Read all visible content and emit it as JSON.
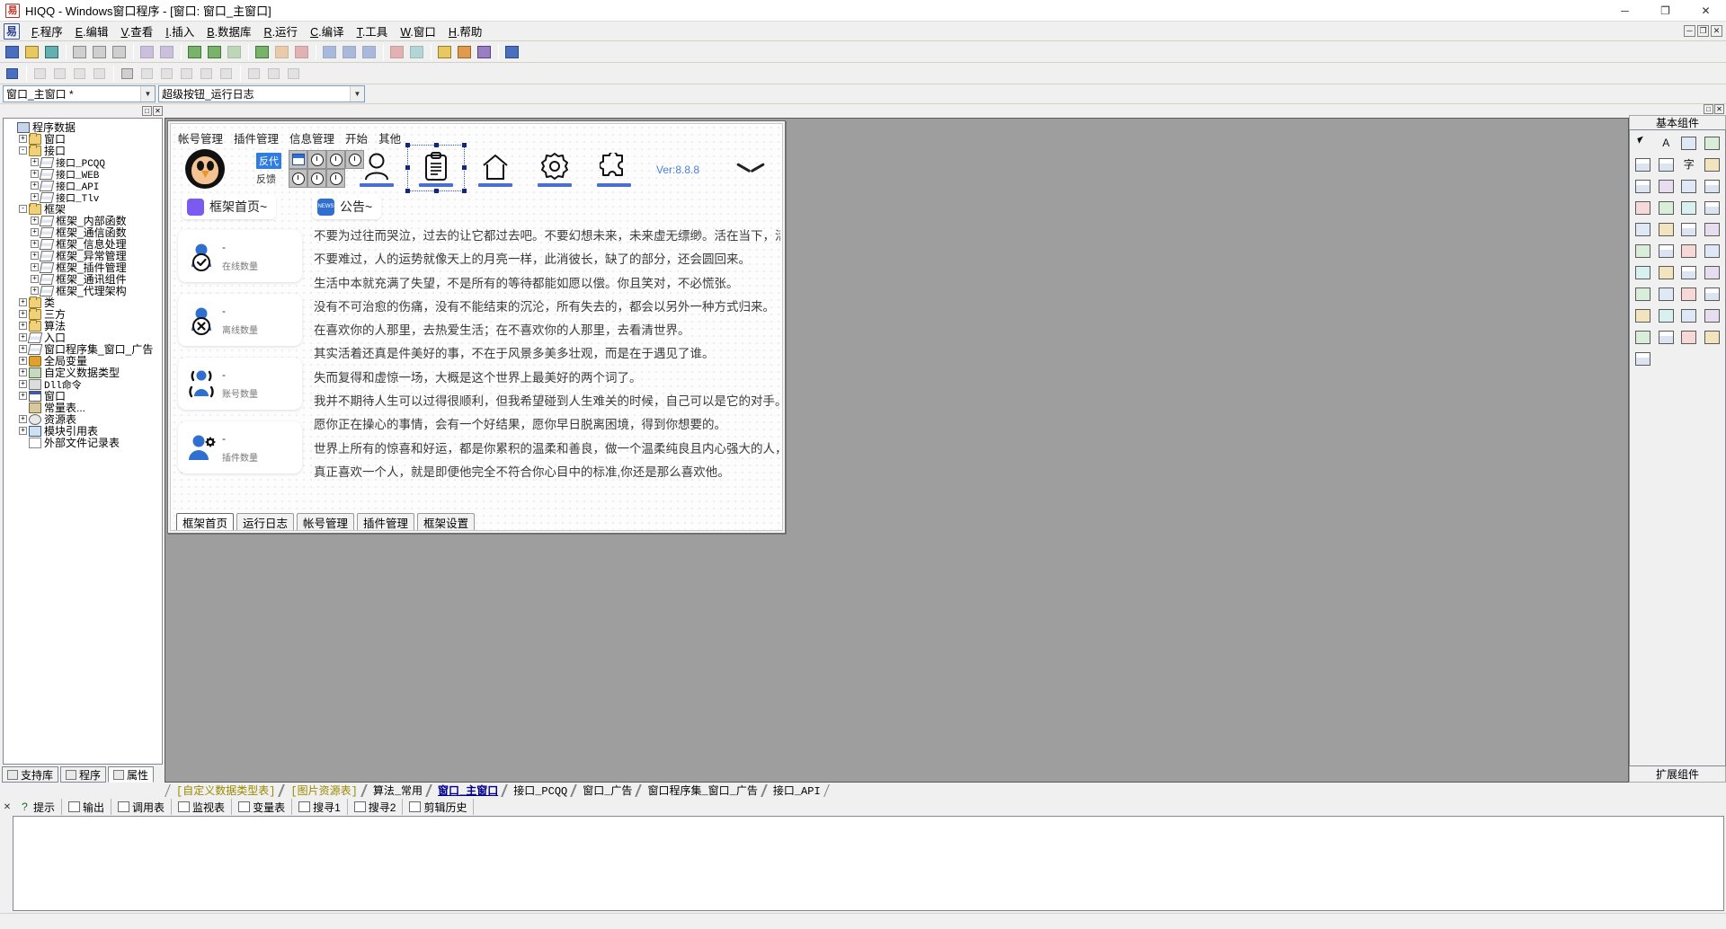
{
  "window": {
    "title": "HIQQ - Windows窗口程序 - [窗口: 窗口_主窗口]",
    "minimize": "─",
    "maximize": "❐",
    "close": "✕"
  },
  "menubar": {
    "items": [
      {
        "key": "F",
        "label": ".程序"
      },
      {
        "key": "E",
        "label": ".编辑"
      },
      {
        "key": "V",
        "label": ".查看"
      },
      {
        "key": "I",
        "label": ".插入"
      },
      {
        "key": "B",
        "label": ".数据库"
      },
      {
        "key": "R",
        "label": ".运行"
      },
      {
        "key": "C",
        "label": ".编译"
      },
      {
        "key": "T",
        "label": ".工具"
      },
      {
        "key": "W",
        "label": ".窗口"
      },
      {
        "key": "H",
        "label": ".帮助"
      }
    ],
    "win_buttons": [
      "─",
      "❐",
      "✕"
    ]
  },
  "combos": {
    "object_selector": "窗口_主窗口 *",
    "event_selector": "超级按钮_运行日志"
  },
  "left_panel": {
    "caption_buttons": [
      "□",
      "✕"
    ],
    "tree": [
      {
        "depth": 0,
        "expander": "",
        "icon": "program-data-icon",
        "label": "程序数据",
        "mono": false
      },
      {
        "depth": 1,
        "expander": "+",
        "icon": "folder-icon",
        "label": "窗口",
        "mono": false
      },
      {
        "depth": 1,
        "expander": "-",
        "icon": "folder-icon",
        "label": "接口",
        "mono": false
      },
      {
        "depth": 2,
        "expander": "+",
        "icon": "module-icon",
        "label": "接口_PCQQ",
        "mono": true
      },
      {
        "depth": 2,
        "expander": "+",
        "icon": "module-icon",
        "label": "接口_WEB",
        "mono": true
      },
      {
        "depth": 2,
        "expander": "+",
        "icon": "module-icon",
        "label": "接口_API",
        "mono": true
      },
      {
        "depth": 2,
        "expander": "+",
        "icon": "module-icon",
        "label": "接口_Tlv",
        "mono": true
      },
      {
        "depth": 1,
        "expander": "-",
        "icon": "folder-icon",
        "label": "框架",
        "mono": false
      },
      {
        "depth": 2,
        "expander": "+",
        "icon": "module-icon",
        "label": "框架_内部函数",
        "mono": false
      },
      {
        "depth": 2,
        "expander": "+",
        "icon": "module-icon",
        "label": "框架_通信函数",
        "mono": false
      },
      {
        "depth": 2,
        "expander": "+",
        "icon": "module-icon",
        "label": "框架_信息处理",
        "mono": false
      },
      {
        "depth": 2,
        "expander": "+",
        "icon": "module-icon",
        "label": "框架_异常管理",
        "mono": false
      },
      {
        "depth": 2,
        "expander": "+",
        "icon": "module-icon",
        "label": "框架_插件管理",
        "mono": false
      },
      {
        "depth": 2,
        "expander": "+",
        "icon": "module-icon",
        "label": "框架_通讯组件",
        "mono": false
      },
      {
        "depth": 2,
        "expander": "+",
        "icon": "module-icon",
        "label": "框架_代理架构",
        "mono": false
      },
      {
        "depth": 1,
        "expander": "+",
        "icon": "folder-icon",
        "label": "类",
        "mono": false
      },
      {
        "depth": 1,
        "expander": "+",
        "icon": "folder-icon",
        "label": "三方",
        "mono": false
      },
      {
        "depth": 1,
        "expander": "+",
        "icon": "folder-icon",
        "label": "算法",
        "mono": false
      },
      {
        "depth": 1,
        "expander": "+",
        "icon": "module-icon",
        "label": "入口",
        "mono": false
      },
      {
        "depth": 1,
        "expander": "+",
        "icon": "module-icon",
        "label": "窗口程序集_窗口_广告",
        "mono": false
      },
      {
        "depth": 1,
        "expander": "+",
        "icon": "variable-icon",
        "label": "全局变量",
        "mono": false
      },
      {
        "depth": 1,
        "expander": "+",
        "icon": "datatype-icon",
        "label": "自定义数据类型",
        "mono": false
      },
      {
        "depth": 1,
        "expander": "+",
        "icon": "dll-icon",
        "label": "Dll命令",
        "mono": true
      },
      {
        "depth": 1,
        "expander": "+",
        "icon": "window-icon",
        "label": "窗口",
        "mono": false
      },
      {
        "depth": 1,
        "expander": "",
        "icon": "const-icon",
        "label": "常量表...",
        "mono": false
      },
      {
        "depth": 1,
        "expander": "+",
        "icon": "resource-icon",
        "label": "资源表",
        "mono": false
      },
      {
        "depth": 1,
        "expander": "+",
        "icon": "moduleref-icon",
        "label": "模块引用表",
        "mono": false
      },
      {
        "depth": 1,
        "expander": "",
        "icon": "file-icon",
        "label": "外部文件记录表",
        "mono": false
      }
    ],
    "tabs": [
      {
        "label": "支持库",
        "icon": "library-icon",
        "active": false
      },
      {
        "label": "程序",
        "icon": "program-icon",
        "active": false
      },
      {
        "label": "属性",
        "icon": "properties-icon",
        "active": true
      }
    ]
  },
  "form": {
    "menu": [
      "帐号管理",
      "插件管理",
      "信息管理",
      "开始",
      "其他"
    ],
    "toolbar": {
      "badge_label": "反代",
      "feedback_label": "反馈",
      "version": "Ver:8.8.8",
      "nav_icons": [
        {
          "name": "user-icon",
          "selected": false
        },
        {
          "name": "clipboard-icon",
          "selected": true
        },
        {
          "name": "home-icon",
          "selected": false
        },
        {
          "name": "gear-icon",
          "selected": false
        },
        {
          "name": "puzzle-icon",
          "selected": false
        }
      ]
    },
    "chips": [
      {
        "label": "框架首页~",
        "icon": "purple-square-icon"
      },
      {
        "label": "公告~",
        "icon": "news-icon"
      }
    ],
    "stat_cards": [
      {
        "value": "-",
        "label": "在线数量",
        "icon": "user-check-icon"
      },
      {
        "value": "-",
        "label": "离线数量",
        "icon": "user-x-icon"
      },
      {
        "value": "-",
        "label": "账号数量",
        "icon": "users-icon"
      },
      {
        "value": "-",
        "label": "插件数量",
        "icon": "user-gear-icon"
      }
    ],
    "text_lines": [
      "不要为过往而哭泣，过去的让它都过去吧。不要幻想未来，未来虚无缥缈。活在当下，活得漂亮。",
      "不要难过，人的运势就像天上的月亮一样，此消彼长，缺了的部分，还会圆回来。",
      "生活中本就充满了失望，不是所有的等待都能如愿以偿。你且笑对，不必慌张。",
      "没有不可治愈的伤痛，没有不能结束的沉沦，所有失去的，都会以另外一种方式归来。",
      "在喜欢你的人那里，去热爱生活；在不喜欢你的人那里，去看清世界。",
      "其实活着还真是件美好的事，不在于风景多美多壮观，而是在于遇见了谁。",
      "失而复得和虚惊一场，大概是这个世界上最美好的两个词了。",
      "我并不期待人生可以过得很顺利，但我希望碰到人生难关的时候，自己可以是它的对手。",
      "愿你正在操心的事情，会有一个好结果，愿你早日脱离困境，得到你想要的。",
      "世界上所有的惊喜和好运，都是你累积的温柔和善良，做一个温柔纯良且内心强大的人，温暖自己",
      "真正喜欢一个人，就是即便他完全不符合你心目中的标准,你还是那么喜欢他。"
    ],
    "bottom_tabs": [
      {
        "label": "框架首页",
        "active": true
      },
      {
        "label": "运行日志",
        "active": false
      },
      {
        "label": "帐号管理",
        "active": false
      },
      {
        "label": "插件管理",
        "active": false
      },
      {
        "label": "框架设置",
        "active": false
      }
    ]
  },
  "right_panel": {
    "caption_buttons": [
      "□",
      "✕"
    ],
    "header": "基本组件",
    "footer": "扩展组件",
    "components": [
      {
        "name": "pointer-tool",
        "glyph": "arrow"
      },
      {
        "name": "label-tool",
        "glyph": "A"
      },
      {
        "name": "picture-tool",
        "glyph": "k2"
      },
      {
        "name": "shape-tool",
        "glyph": "k4"
      },
      {
        "name": "edit-tool",
        "glyph": "k1"
      },
      {
        "name": "combo-tool",
        "glyph": "k1"
      },
      {
        "name": "text-tool",
        "glyph": "字"
      },
      {
        "name": "group-tool",
        "glyph": "k3"
      },
      {
        "name": "check-tool",
        "glyph": "k1"
      },
      {
        "name": "radio-tool",
        "glyph": "k5"
      },
      {
        "name": "list-tool",
        "glyph": "k2"
      },
      {
        "name": "listview-tool",
        "glyph": "k1"
      },
      {
        "name": "grid-tool",
        "glyph": "k6"
      },
      {
        "name": "tree-tool",
        "glyph": "k4"
      },
      {
        "name": "progress-tool",
        "glyph": "k7"
      },
      {
        "name": "slider-tool",
        "glyph": "k1"
      },
      {
        "name": "line-tool",
        "glyph": "k2"
      },
      {
        "name": "frame-tool",
        "glyph": "k3"
      },
      {
        "name": "tab-tool",
        "glyph": "k1"
      },
      {
        "name": "panel-tool",
        "glyph": "k5"
      },
      {
        "name": "image-tool",
        "glyph": "k4"
      },
      {
        "name": "button-tool",
        "glyph": "k1"
      },
      {
        "name": "date-tool",
        "glyph": "k6"
      },
      {
        "name": "timer-tool",
        "glyph": "k2"
      },
      {
        "name": "menu-tool",
        "glyph": "k7"
      },
      {
        "name": "dialog-tool",
        "glyph": "k3"
      },
      {
        "name": "scroll-tool",
        "glyph": "k1"
      },
      {
        "name": "media-tool",
        "glyph": "k5"
      },
      {
        "name": "net-tool",
        "glyph": "k4"
      },
      {
        "name": "db-tool",
        "glyph": "k2"
      },
      {
        "name": "chart-tool",
        "glyph": "k6"
      },
      {
        "name": "misc-tool",
        "glyph": "k1"
      },
      {
        "name": "extra-tool-1",
        "glyph": "k3"
      },
      {
        "name": "extra-tool-2",
        "glyph": "k7"
      },
      {
        "name": "extra-tool-3",
        "glyph": "k2"
      },
      {
        "name": "extra-tool-4",
        "glyph": "k5"
      },
      {
        "name": "extra-tool-5",
        "glyph": "k4"
      },
      {
        "name": "extra-tool-6",
        "glyph": "k1"
      },
      {
        "name": "extra-tool-7",
        "glyph": "k6"
      },
      {
        "name": "extra-tool-8",
        "glyph": "k3"
      },
      {
        "name": "extra-tool-9",
        "glyph": "k1"
      }
    ]
  },
  "document_tabs": [
    {
      "label": "[自定义数据类型表]",
      "style": "yellow"
    },
    {
      "label": "[图片资源表]",
      "style": "yellow"
    },
    {
      "label": "算法_常用",
      "style": "normal"
    },
    {
      "label": "窗口_主窗口",
      "style": "active"
    },
    {
      "label": "接口_PCQQ",
      "style": "normal"
    },
    {
      "label": "窗口_广告",
      "style": "normal"
    },
    {
      "label": "窗口程序集_窗口_广告",
      "style": "normal"
    },
    {
      "label": "接口_API",
      "style": "normal"
    }
  ],
  "output_panel": {
    "close_glyph": "✕",
    "tabs": [
      {
        "label": "提示",
        "icon": "lightbulb-icon"
      },
      {
        "label": "输出",
        "icon": "output-icon"
      },
      {
        "label": "调用表",
        "icon": "calltable-icon"
      },
      {
        "label": "监视表",
        "icon": "magnifier-icon"
      },
      {
        "label": "变量表",
        "icon": "variable-icon"
      },
      {
        "label": "搜寻1",
        "icon": "find1-icon"
      },
      {
        "label": "搜寻2",
        "icon": "find2-icon"
      },
      {
        "label": "剪辑历史",
        "icon": "clipboard-history-icon"
      }
    ]
  },
  "colors": {
    "accent_blue": "#2f6fd0",
    "nav_underline": "#4a6fd4",
    "version_text": "#4a7fe0",
    "tab_active": "#00008b",
    "tab_yellow": "#9a8800"
  }
}
